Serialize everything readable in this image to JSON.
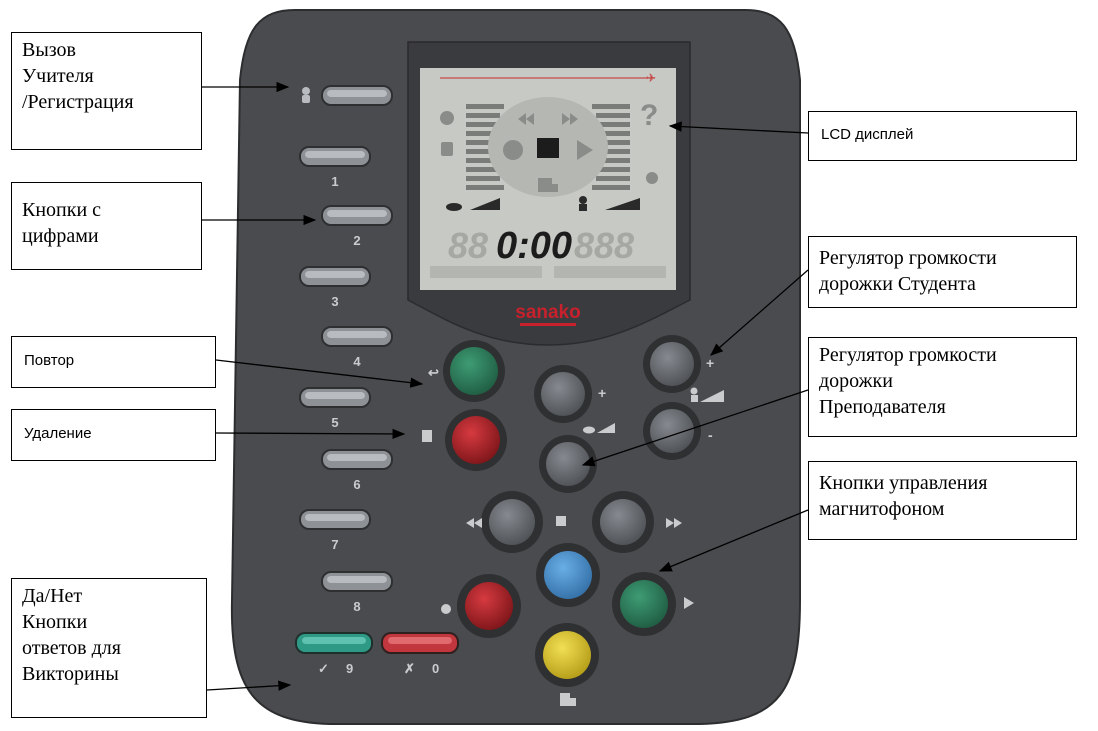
{
  "callouts": {
    "call_register": "Вызов\nУчителя\n/Регистрация",
    "number_keys": "Кнопки с\nцифрами",
    "repeat": "Повтор",
    "delete": "Удаление",
    "yes_no": "Да/Нет\nКнопки\nответов для\nВикторины",
    "lcd": "LCD дисплей",
    "student_volume": "Регулятор громкости\nдорожки Студента",
    "teacher_volume": "Регулятор громкости\nдорожки\nПреподавателя",
    "recorder_controls": "Кнопки управления\nмагнитофоном"
  },
  "device": {
    "brand": "sanako",
    "lcd_time": "0:00",
    "lcd_left_digits": "88",
    "lcd_right_digits": "888",
    "key_numbers": [
      "1",
      "2",
      "3",
      "4",
      "5",
      "6",
      "7",
      "8"
    ],
    "yes_key_label": "9",
    "no_key_label": "0",
    "lcd_help_glyph": "?",
    "colors": {
      "body": "#4a4b4e",
      "lcd": "#c7c9c4",
      "green": "#2f7d5c",
      "red": "#b02028",
      "blue": "#4d93d2",
      "yellow": "#e6cf2a",
      "grey_button": "#6b6e73",
      "yes_key": "#2e9a86",
      "no_key": "#c2373d"
    }
  }
}
